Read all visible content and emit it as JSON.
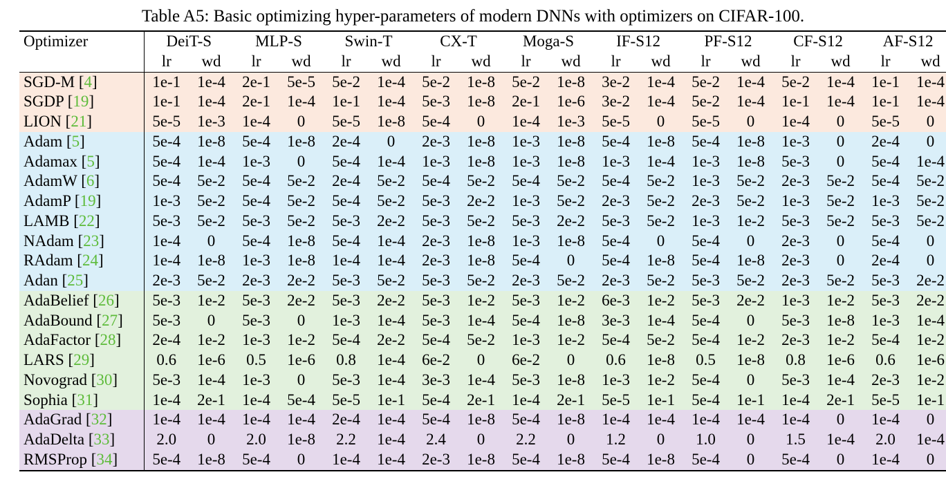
{
  "caption": "Table A5: Basic optimizing hyper-parameters of modern DNNs with optimizers on CIFAR-100.",
  "header": {
    "optimizer_label": "Optimizer",
    "sub_lr": "lr",
    "sub_wd": "wd",
    "models": [
      "DeiT-S",
      "MLP-S",
      "Swin-T",
      "CX-T",
      "Moga-S",
      "IF-S12",
      "PF-S12",
      "CF-S12",
      "AF-S12"
    ]
  },
  "groups": [
    {
      "bg": "bg-peach",
      "rows": [
        {
          "name": "SGD-M",
          "ref": "4",
          "vals": [
            "1e-1",
            "1e-4",
            "2e-1",
            "5e-5",
            "5e-2",
            "1e-4",
            "5e-2",
            "1e-8",
            "5e-2",
            "1e-8",
            "3e-2",
            "1e-4",
            "5e-2",
            "1e-4",
            "5e-2",
            "1e-4",
            "1e-1",
            "1e-4"
          ]
        },
        {
          "name": "SGDP",
          "ref": "19",
          "vals": [
            "1e-1",
            "1e-4",
            "2e-1",
            "1e-4",
            "1e-1",
            "1e-4",
            "5e-3",
            "1e-8",
            "2e-1",
            "1e-6",
            "3e-2",
            "1e-4",
            "5e-2",
            "1e-4",
            "1e-1",
            "1e-4",
            "1e-1",
            "1e-4"
          ]
        },
        {
          "name": "LION",
          "ref": "21",
          "vals": [
            "5e-5",
            "1e-3",
            "1e-4",
            "0",
            "5e-5",
            "1e-8",
            "5e-4",
            "0",
            "1e-4",
            "1e-3",
            "5e-5",
            "0",
            "5e-5",
            "0",
            "1e-4",
            "0",
            "5e-5",
            "0"
          ]
        }
      ]
    },
    {
      "bg": "bg-blue",
      "rows": [
        {
          "name": "Adam",
          "ref": "5",
          "vals": [
            "5e-4",
            "1e-8",
            "5e-4",
            "1e-8",
            "2e-4",
            "0",
            "2e-3",
            "1e-8",
            "1e-3",
            "1e-8",
            "5e-4",
            "1e-8",
            "5e-4",
            "1e-8",
            "1e-3",
            "0",
            "2e-4",
            "0"
          ]
        },
        {
          "name": "Adamax",
          "ref": "5",
          "vals": [
            "5e-4",
            "1e-4",
            "1e-3",
            "0",
            "5e-4",
            "1e-4",
            "1e-3",
            "1e-8",
            "1e-3",
            "1e-8",
            "1e-3",
            "1e-4",
            "1e-3",
            "1e-8",
            "5e-3",
            "0",
            "5e-4",
            "1e-4"
          ]
        },
        {
          "name": "AdamW",
          "ref": "6",
          "vals": [
            "5e-4",
            "5e-2",
            "5e-4",
            "5e-2",
            "2e-4",
            "5e-2",
            "5e-4",
            "5e-2",
            "5e-4",
            "5e-2",
            "5e-4",
            "5e-2",
            "1e-3",
            "5e-2",
            "2e-3",
            "5e-2",
            "5e-4",
            "5e-2"
          ]
        },
        {
          "name": "AdamP",
          "ref": "19",
          "vals": [
            "1e-3",
            "5e-2",
            "5e-4",
            "5e-2",
            "5e-4",
            "5e-2",
            "5e-3",
            "2e-2",
            "1e-3",
            "5e-2",
            "2e-3",
            "5e-2",
            "2e-3",
            "5e-2",
            "1e-3",
            "5e-2",
            "1e-3",
            "5e-2"
          ]
        },
        {
          "name": "LAMB",
          "ref": "22",
          "vals": [
            "5e-3",
            "5e-2",
            "5e-3",
            "5e-2",
            "5e-3",
            "2e-2",
            "5e-3",
            "5e-2",
            "5e-3",
            "2e-2",
            "5e-3",
            "5e-2",
            "1e-3",
            "1e-2",
            "5e-3",
            "5e-2",
            "5e-3",
            "5e-2"
          ]
        },
        {
          "name": "NAdam",
          "ref": "23",
          "vals": [
            "1e-4",
            "0",
            "5e-4",
            "1e-8",
            "5e-4",
            "1e-4",
            "2e-3",
            "1e-8",
            "1e-3",
            "1e-8",
            "5e-4",
            "0",
            "5e-4",
            "0",
            "2e-3",
            "0",
            "5e-4",
            "0"
          ]
        },
        {
          "name": "RAdam",
          "ref": "24",
          "vals": [
            "1e-4",
            "1e-8",
            "1e-3",
            "1e-8",
            "1e-4",
            "1e-4",
            "2e-3",
            "1e-8",
            "5e-4",
            "0",
            "5e-4",
            "1e-8",
            "5e-4",
            "1e-8",
            "2e-3",
            "0",
            "2e-4",
            "0"
          ]
        },
        {
          "name": "Adan",
          "ref": "25",
          "vals": [
            "2e-3",
            "5e-2",
            "2e-3",
            "2e-2",
            "5e-3",
            "5e-2",
            "5e-3",
            "5e-2",
            "2e-3",
            "5e-2",
            "2e-3",
            "5e-2",
            "5e-3",
            "5e-2",
            "2e-3",
            "5e-2",
            "5e-3",
            "2e-2"
          ]
        }
      ]
    },
    {
      "bg": "bg-green",
      "rows": [
        {
          "name": "AdaBelief",
          "ref": "26",
          "vals": [
            "5e-3",
            "1e-2",
            "5e-3",
            "2e-2",
            "5e-3",
            "2e-2",
            "5e-3",
            "1e-2",
            "5e-3",
            "1e-2",
            "6e-3",
            "1e-2",
            "5e-3",
            "2e-2",
            "1e-3",
            "1e-2",
            "5e-3",
            "2e-2"
          ]
        },
        {
          "name": "AdaBound",
          "ref": "27",
          "vals": [
            "5e-3",
            "0",
            "5e-3",
            "0",
            "1e-3",
            "1e-4",
            "5e-3",
            "1e-4",
            "5e-4",
            "1e-8",
            "3e-3",
            "1e-4",
            "5e-4",
            "0",
            "5e-3",
            "1e-8",
            "1e-3",
            "1e-4"
          ]
        },
        {
          "name": "AdaFactor",
          "ref": "28",
          "vals": [
            "2e-4",
            "1e-2",
            "1e-3",
            "1e-2",
            "5e-4",
            "2e-2",
            "5e-4",
            "5e-2",
            "1e-3",
            "1e-2",
            "5e-4",
            "5e-2",
            "5e-4",
            "1e-2",
            "2e-3",
            "1e-2",
            "5e-4",
            "1e-2"
          ]
        },
        {
          "name": "LARS",
          "ref": "29",
          "vals": [
            "0.6",
            "1e-6",
            "0.5",
            "1e-6",
            "0.8",
            "1e-4",
            "6e-2",
            "0",
            "6e-2",
            "0",
            "0.6",
            "1e-8",
            "0.5",
            "1e-8",
            "0.8",
            "1e-6",
            "0.6",
            "1e-6"
          ]
        },
        {
          "name": "Novograd",
          "ref": "30",
          "vals": [
            "5e-3",
            "1e-4",
            "1e-3",
            "0",
            "5e-3",
            "1e-4",
            "3e-3",
            "1e-4",
            "5e-3",
            "1e-8",
            "1e-3",
            "1e-2",
            "5e-4",
            "0",
            "5e-3",
            "1e-4",
            "2e-3",
            "1e-2"
          ]
        },
        {
          "name": "Sophia",
          "ref": "31",
          "vals": [
            "1e-4",
            "2e-1",
            "1e-4",
            "5e-4",
            "5e-5",
            "1e-1",
            "5e-4",
            "2e-1",
            "1e-4",
            "2e-1",
            "5e-5",
            "1e-1",
            "5e-4",
            "1e-1",
            "1e-4",
            "2e-1",
            "5e-5",
            "1e-1"
          ]
        }
      ]
    },
    {
      "bg": "bg-purp",
      "rows": [
        {
          "name": "AdaGrad",
          "ref": "32",
          "vals": [
            "1e-4",
            "1e-4",
            "1e-4",
            "1e-4",
            "2e-4",
            "1e-4",
            "5e-4",
            "1e-8",
            "5e-4",
            "1e-8",
            "1e-4",
            "1e-4",
            "1e-4",
            "1e-4",
            "1e-4",
            "0",
            "1e-4",
            "0"
          ]
        },
        {
          "name": "AdaDelta",
          "ref": "33",
          "vals": [
            "2.0",
            "0",
            "2.0",
            "1e-8",
            "2.2",
            "1e-4",
            "2.4",
            "0",
            "2.2",
            "0",
            "1.2",
            "0",
            "1.0",
            "0",
            "1.5",
            "1e-4",
            "2.0",
            "1e-4"
          ]
        },
        {
          "name": "RMSProp",
          "ref": "34",
          "vals": [
            "5e-4",
            "1e-8",
            "5e-4",
            "0",
            "1e-4",
            "1e-4",
            "2e-3",
            "1e-8",
            "5e-4",
            "1e-8",
            "5e-4",
            "1e-8",
            "5e-4",
            "0",
            "5e-4",
            "0",
            "1e-4",
            "0"
          ]
        }
      ]
    }
  ],
  "chart_data": {
    "type": "table",
    "title": "Basic optimizing hyper-parameters of modern DNNs with optimizers on CIFAR-100",
    "models": [
      "DeiT-S",
      "MLP-S",
      "Swin-T",
      "CX-T",
      "Moga-S",
      "IF-S12",
      "PF-S12",
      "CF-S12",
      "AF-S12"
    ],
    "metrics_per_model": [
      "lr",
      "wd"
    ],
    "optimizers": [
      "SGD-M",
      "SGDP",
      "LION",
      "Adam",
      "Adamax",
      "AdamW",
      "AdamP",
      "LAMB",
      "NAdam",
      "RAdam",
      "Adan",
      "AdaBelief",
      "AdaBound",
      "AdaFactor",
      "LARS",
      "Novograd",
      "Sophia",
      "AdaGrad",
      "AdaDelta",
      "RMSProp"
    ]
  }
}
